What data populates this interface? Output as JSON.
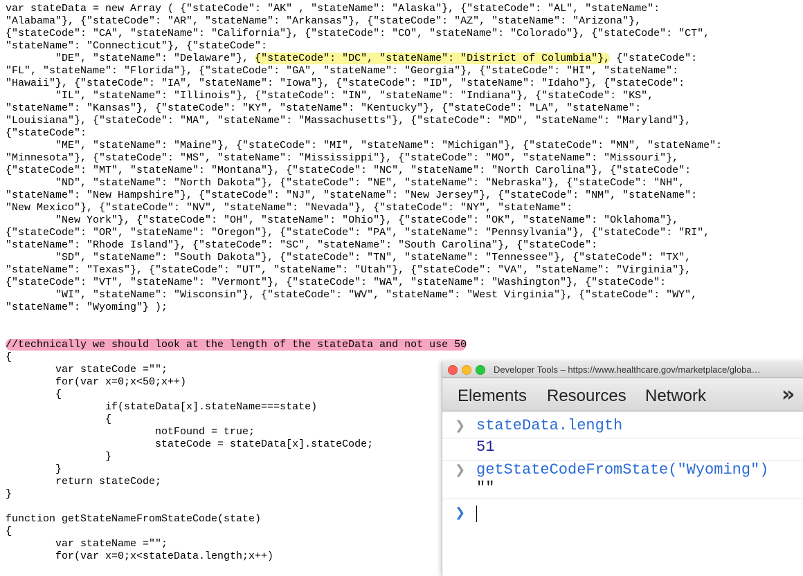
{
  "code": {
    "lines": [
      "var stateData = new Array ( {\"stateCode\": \"AK\" , \"stateName\": \"Alaska\"}, {\"stateCode\": \"AL\", \"stateName\":",
      "\"Alabama\"}, {\"stateCode\": \"AR\", \"stateName\": \"Arkansas\"}, {\"stateCode\": \"AZ\", \"stateName\": \"Arizona\"},",
      "{\"stateCode\": \"CA\", \"stateName\": \"California\"}, {\"stateCode\": \"CO\", \"stateName\": \"Colorado\"}, {\"stateCode\": \"CT\",",
      "\"stateName\": \"Connecticut\"}, {\"stateCode\":",
      "        \"DE\", \"stateName\": \"Delaware\"}, ",
      "\"FL\", \"stateName\": \"Florida\"}, {\"stateCode\": \"GA\", \"stateName\": \"Georgia\"}, {\"stateCode\": \"HI\", \"stateName\":",
      "\"Hawaii\"}, {\"stateCode\": \"IA\", \"stateName\": \"Iowa\"}, {\"stateCode\": \"ID\", \"stateName\": \"Idaho\"}, {\"stateCode\":",
      "        \"IL\", \"stateName\": \"Illinois\"}, {\"stateCode\": \"IN\", \"stateName\": \"Indiana\"}, {\"stateCode\": \"KS\",",
      "\"stateName\": \"Kansas\"}, {\"stateCode\": \"KY\", \"stateName\": \"Kentucky\"}, {\"stateCode\": \"LA\", \"stateName\":",
      "\"Louisiana\"}, {\"stateCode\": \"MA\", \"stateName\": \"Massachusetts\"}, {\"stateCode\": \"MD\", \"stateName\": \"Maryland\"},",
      "{\"stateCode\":",
      "        \"ME\", \"stateName\": \"Maine\"}, {\"stateCode\": \"MI\", \"stateName\": \"Michigan\"}, {\"stateCode\": \"MN\", \"stateName\":",
      "\"Minnesota\"}, {\"stateCode\": \"MS\", \"stateName\": \"Mississippi\"}, {\"stateCode\": \"MO\", \"stateName\": \"Missouri\"},",
      "{\"stateCode\": \"MT\", \"stateName\": \"Montana\"}, {\"stateCode\": \"NC\", \"stateName\": \"North Carolina\"}, {\"stateCode\":",
      "        \"ND\", \"stateName\": \"North Dakota\"}, {\"stateCode\": \"NE\", \"stateName\": \"Nebraska\"}, {\"stateCode\": \"NH\",",
      "\"stateName\": \"New Hampshire\"}, {\"stateCode\": \"NJ\", \"stateName\": \"New Jersey\"}, {\"stateCode\": \"NM\", \"stateName\":",
      "\"New Mexico\"}, {\"stateCode\": \"NV\", \"stateName\": \"Nevada\"}, {\"stateCode\": \"NY\", \"stateName\":",
      "        \"New York\"}, {\"stateCode\": \"OH\", \"stateName\": \"Ohio\"}, {\"stateCode\": \"OK\", \"stateName\": \"Oklahoma\"},",
      "{\"stateCode\": \"OR\", \"stateName\": \"Oregon\"}, {\"stateCode\": \"PA\", \"stateName\": \"Pennsylvania\"}, {\"stateCode\": \"RI\",",
      "\"stateName\": \"Rhode Island\"}, {\"stateCode\": \"SC\", \"stateName\": \"South Carolina\"}, {\"stateCode\":",
      "        \"SD\", \"stateName\": \"South Dakota\"}, {\"stateCode\": \"TN\", \"stateName\": \"Tennessee\"}, {\"stateCode\": \"TX\",",
      "\"stateName\": \"Texas\"}, {\"stateCode\": \"UT\", \"stateName\": \"Utah\"}, {\"stateCode\": \"VA\", \"stateName\": \"Virginia\"},",
      "{\"stateCode\": \"VT\", \"stateName\": \"Vermont\"}, {\"stateCode\": \"WA\", \"stateName\": \"Washington\"}, {\"stateCode\":",
      "        \"WI\", \"stateName\": \"Wisconsin\"}, {\"stateCode\": \"WV\", \"stateName\": \"West Virginia\"}, {\"stateCode\": \"WY\",",
      "\"stateName\": \"Wyoming\"} );",
      "",
      "",
      "function getStateCodeFromState(state)",
      "{",
      "        var stateCode =\"\";",
      "        for(var x=0;x<50;x++)",
      "        {",
      "                if(stateData[x].stateName===state)",
      "                {",
      "                        notFound = true;",
      "                        stateCode = stateData[x].stateCode;",
      "                }",
      "        }",
      "        return stateCode;",
      "}",
      "",
      "function getStateNameFromStateCode(state)",
      "{",
      "        var stateName =\"\";",
      "        for(var x=0;x<stateData.length;x++)"
    ],
    "dc_highlight": "{\"stateCode\": \"DC\", \"stateName\": \"District of Columbia\"},",
    "dc_after": " {\"stateCode\":",
    "comment": "//technically we should look at the length of the stateData and not use 50",
    "highlight_colors": {
      "yellow": "#fbf79a",
      "pink": "#f7a6c2"
    }
  },
  "devtools": {
    "title": "Developer Tools – https://www.healthcare.gov/marketplace/globa…",
    "tabs": [
      "Elements",
      "Resources",
      "Network"
    ],
    "overflow_label": "»",
    "console": [
      {
        "type": "input",
        "text": "stateData.length"
      },
      {
        "type": "output",
        "text": "51"
      },
      {
        "type": "input",
        "text": "getStateCodeFromState(\"Wyoming\")"
      },
      {
        "type": "output",
        "text": "\"\""
      }
    ],
    "accent_color": "#2a6bd6"
  }
}
